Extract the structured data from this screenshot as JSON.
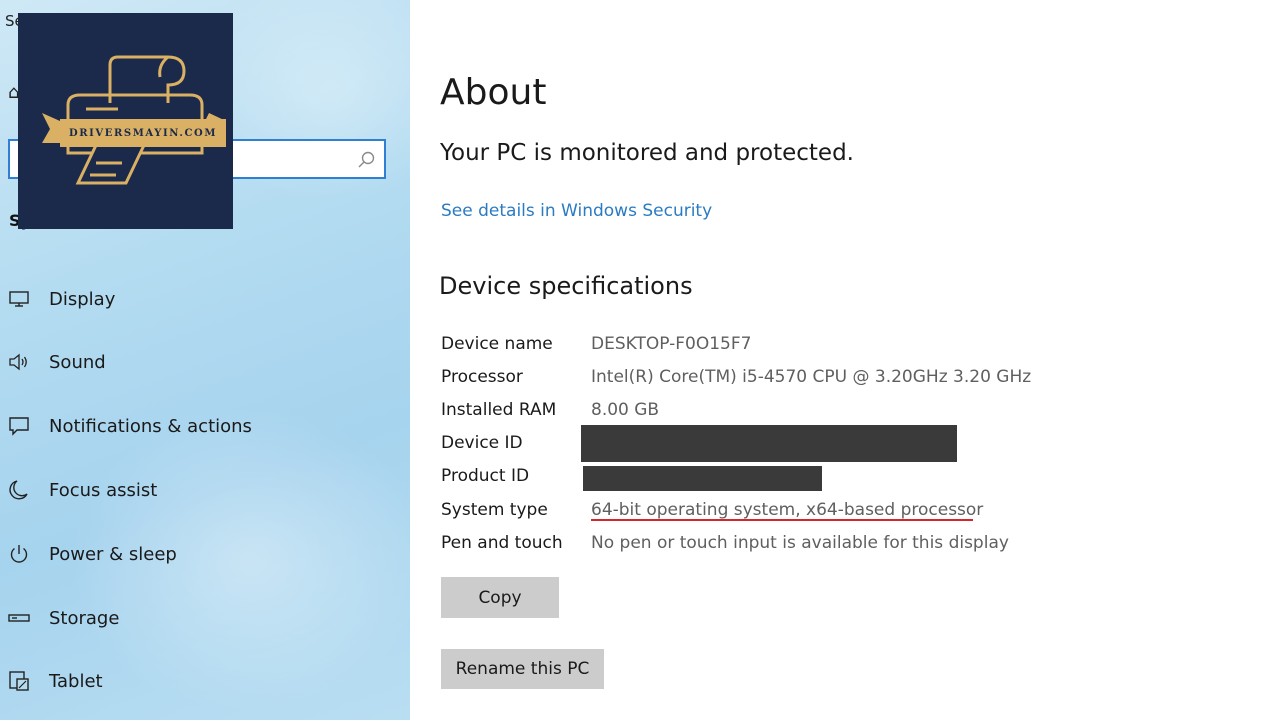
{
  "sidebar": {
    "top_text": "Se",
    "search": {
      "value": "",
      "placeholder": ""
    },
    "section_heading": "Sy",
    "items": [
      {
        "label": "Display",
        "icon": "monitor-icon"
      },
      {
        "label": "Sound",
        "icon": "speaker-icon"
      },
      {
        "label": "Notifications & actions",
        "icon": "notification-icon"
      },
      {
        "label": "Focus assist",
        "icon": "moon-icon"
      },
      {
        "label": "Power & sleep",
        "icon": "power-icon"
      },
      {
        "label": "Storage",
        "icon": "storage-icon"
      },
      {
        "label": "Tablet",
        "icon": "tablet-icon"
      }
    ]
  },
  "logo": {
    "text": "DRIVERSMAYIN.COM",
    "bg_color": "#1b2a4a",
    "accent_color": "#d9b064"
  },
  "main": {
    "title": "About",
    "protection_text": "Your PC is monitored and protected.",
    "security_link": "See details in Windows Security",
    "specs_heading": "Device specifications",
    "specs": [
      {
        "label": "Device name",
        "value": "DESKTOP-F0O15F7"
      },
      {
        "label": "Processor",
        "value": "Intel(R) Core(TM) i5-4570 CPU @ 3.20GHz   3.20 GHz"
      },
      {
        "label": "Installed RAM",
        "value": "8.00 GB"
      },
      {
        "label": "Device ID",
        "value": ""
      },
      {
        "label": "Product ID",
        "value": ""
      },
      {
        "label": "System type",
        "value": "64-bit operating system, x64-based processor"
      },
      {
        "label": "Pen and touch",
        "value": "No pen or touch input is available for this display"
      }
    ],
    "copy_button": "Copy",
    "rename_button": "Rename this PC"
  },
  "colors": {
    "link": "#2a7bc2",
    "search_border": "#2f7fd2",
    "highlight_underline": "#d6262c",
    "button_bg": "#cccccc"
  }
}
